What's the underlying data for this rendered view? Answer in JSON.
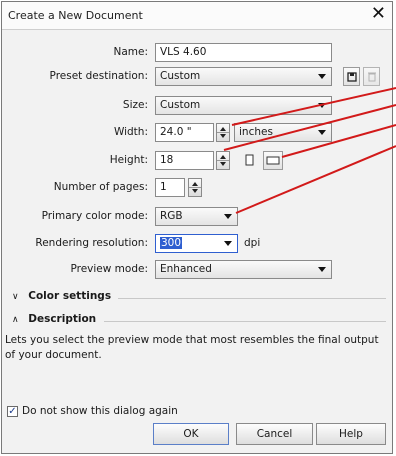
{
  "dialog": {
    "title": "Create a New Document",
    "close_glyph": "✕"
  },
  "form": {
    "name_label": "Name:",
    "name_value": "VLS 4.60",
    "preset_label": "Preset destination:",
    "preset_value": "Custom",
    "size_label": "Size:",
    "size_value": "Custom",
    "width_label": "Width:",
    "width_value": "24.0 \"",
    "units_value": "inches",
    "height_label": "Height:",
    "height_value": "18",
    "pages_label": "Number of pages:",
    "pages_value": "1",
    "color_mode_label": "Primary color mode:",
    "color_mode_value": "RGB",
    "resolution_label": "Rendering resolution:",
    "resolution_value": "300",
    "resolution_unit": "dpi",
    "preview_label": "Preview mode:",
    "preview_value": "Enhanced"
  },
  "sections": {
    "color_settings": "Color settings",
    "description": "Description",
    "description_text": "Lets you select the preview mode that most resembles the final output of your document."
  },
  "footer": {
    "checkbox_label": "Do not show this dialog again",
    "checkbox_checked": true,
    "ok": "OK",
    "cancel": "Cancel",
    "help": "Help"
  },
  "icons": {
    "save": "save-preset-icon",
    "delete": "delete-preset-icon",
    "portrait": "portrait-icon",
    "landscape": "landscape-icon",
    "chevron_collapsed": "chevron-down-icon",
    "chevron_expanded": "chevron-up-icon",
    "close": "close-icon"
  },
  "colors": {
    "annotation_arrow": "#d21a1a",
    "selection": "#2f5fd0"
  }
}
